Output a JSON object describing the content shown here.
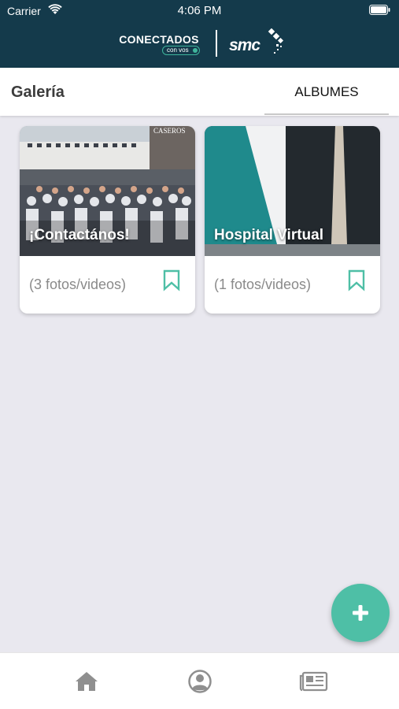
{
  "status_bar": {
    "carrier": "Carrier",
    "time": "4:06 PM"
  },
  "brand": {
    "app_name": "CONECTADOS",
    "tagline": "con vos",
    "logo_text": "smc"
  },
  "page": {
    "title": "Galería",
    "active_tab": "ALBUMES"
  },
  "albums": [
    {
      "title": "¡Contactános!",
      "count_label": "(3 fotos/videos)",
      "icon": "bookmark-icon"
    },
    {
      "title": "Hospital Virtual",
      "count_label": "(1 fotos/videos)",
      "icon": "bookmark-icon"
    }
  ],
  "fab": {
    "icon": "plus-icon"
  },
  "bottom_nav": [
    {
      "icon": "home-icon"
    },
    {
      "icon": "profile-icon"
    },
    {
      "icon": "news-icon"
    }
  ],
  "colors": {
    "header_bg": "#143a4b",
    "accent": "#4ebfa6",
    "page_bg": "#e9e8ef"
  }
}
